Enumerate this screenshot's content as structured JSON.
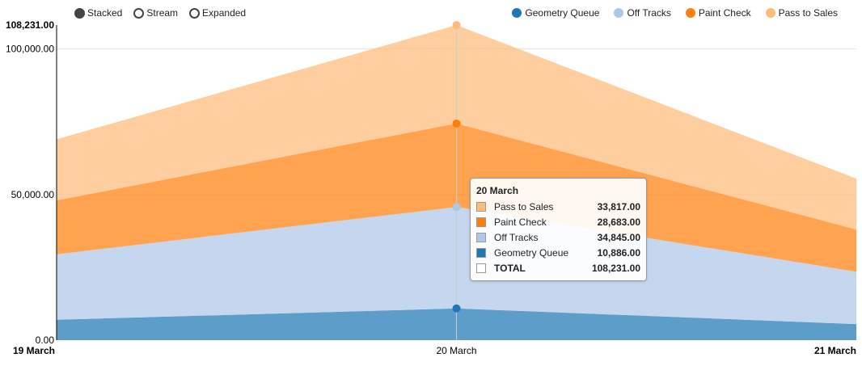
{
  "controls": {
    "items": [
      {
        "label": "Stacked",
        "selected": true
      },
      {
        "label": "Stream",
        "selected": false
      },
      {
        "label": "Expanded",
        "selected": false
      }
    ]
  },
  "legend": {
    "items": [
      {
        "label": "Geometry Queue",
        "color": "#1f77b4"
      },
      {
        "label": "Off Tracks",
        "color": "#aec7e8"
      },
      {
        "label": "Paint Check",
        "color": "#ff7f0e"
      },
      {
        "label": "Pass to Sales",
        "color": "#ffbb78"
      }
    ]
  },
  "chart_data": {
    "type": "area",
    "stacked": true,
    "x": [
      "19 March",
      "20 March",
      "21 March"
    ],
    "series": [
      {
        "name": "Geometry Queue",
        "color": "#1f77b4",
        "values": [
          7000,
          10886,
          5500
        ]
      },
      {
        "name": "Off Tracks",
        "color": "#aec7e8",
        "values": [
          22500,
          34845,
          18000
        ]
      },
      {
        "name": "Paint Check",
        "color": "#ff7f0e",
        "values": [
          18500,
          28683,
          14500
        ]
      },
      {
        "name": "Pass to Sales",
        "color": "#ffbb78",
        "values": [
          21000,
          33817,
          17500
        ]
      }
    ],
    "y_ticks": [
      "0.00",
      "50,000.00",
      "100,000.00",
      "108,231.00"
    ],
    "y_tick_values": [
      0,
      50000,
      100000,
      108231
    ],
    "ylim": [
      0,
      108231
    ],
    "grid": true
  },
  "tooltip": {
    "title": "20 March",
    "rows": [
      {
        "name": "Pass to Sales",
        "value": "33,817.00",
        "color": "#ffbb78"
      },
      {
        "name": "Paint Check",
        "value": "28,683.00",
        "color": "#ff7f0e"
      },
      {
        "name": "Off Tracks",
        "value": "34,845.00",
        "color": "#aec7e8"
      },
      {
        "name": "Geometry Queue",
        "value": "10,886.00",
        "color": "#1f77b4"
      },
      {
        "name": "TOTAL",
        "value": "108,231.00",
        "color": "#ffffff"
      }
    ]
  }
}
